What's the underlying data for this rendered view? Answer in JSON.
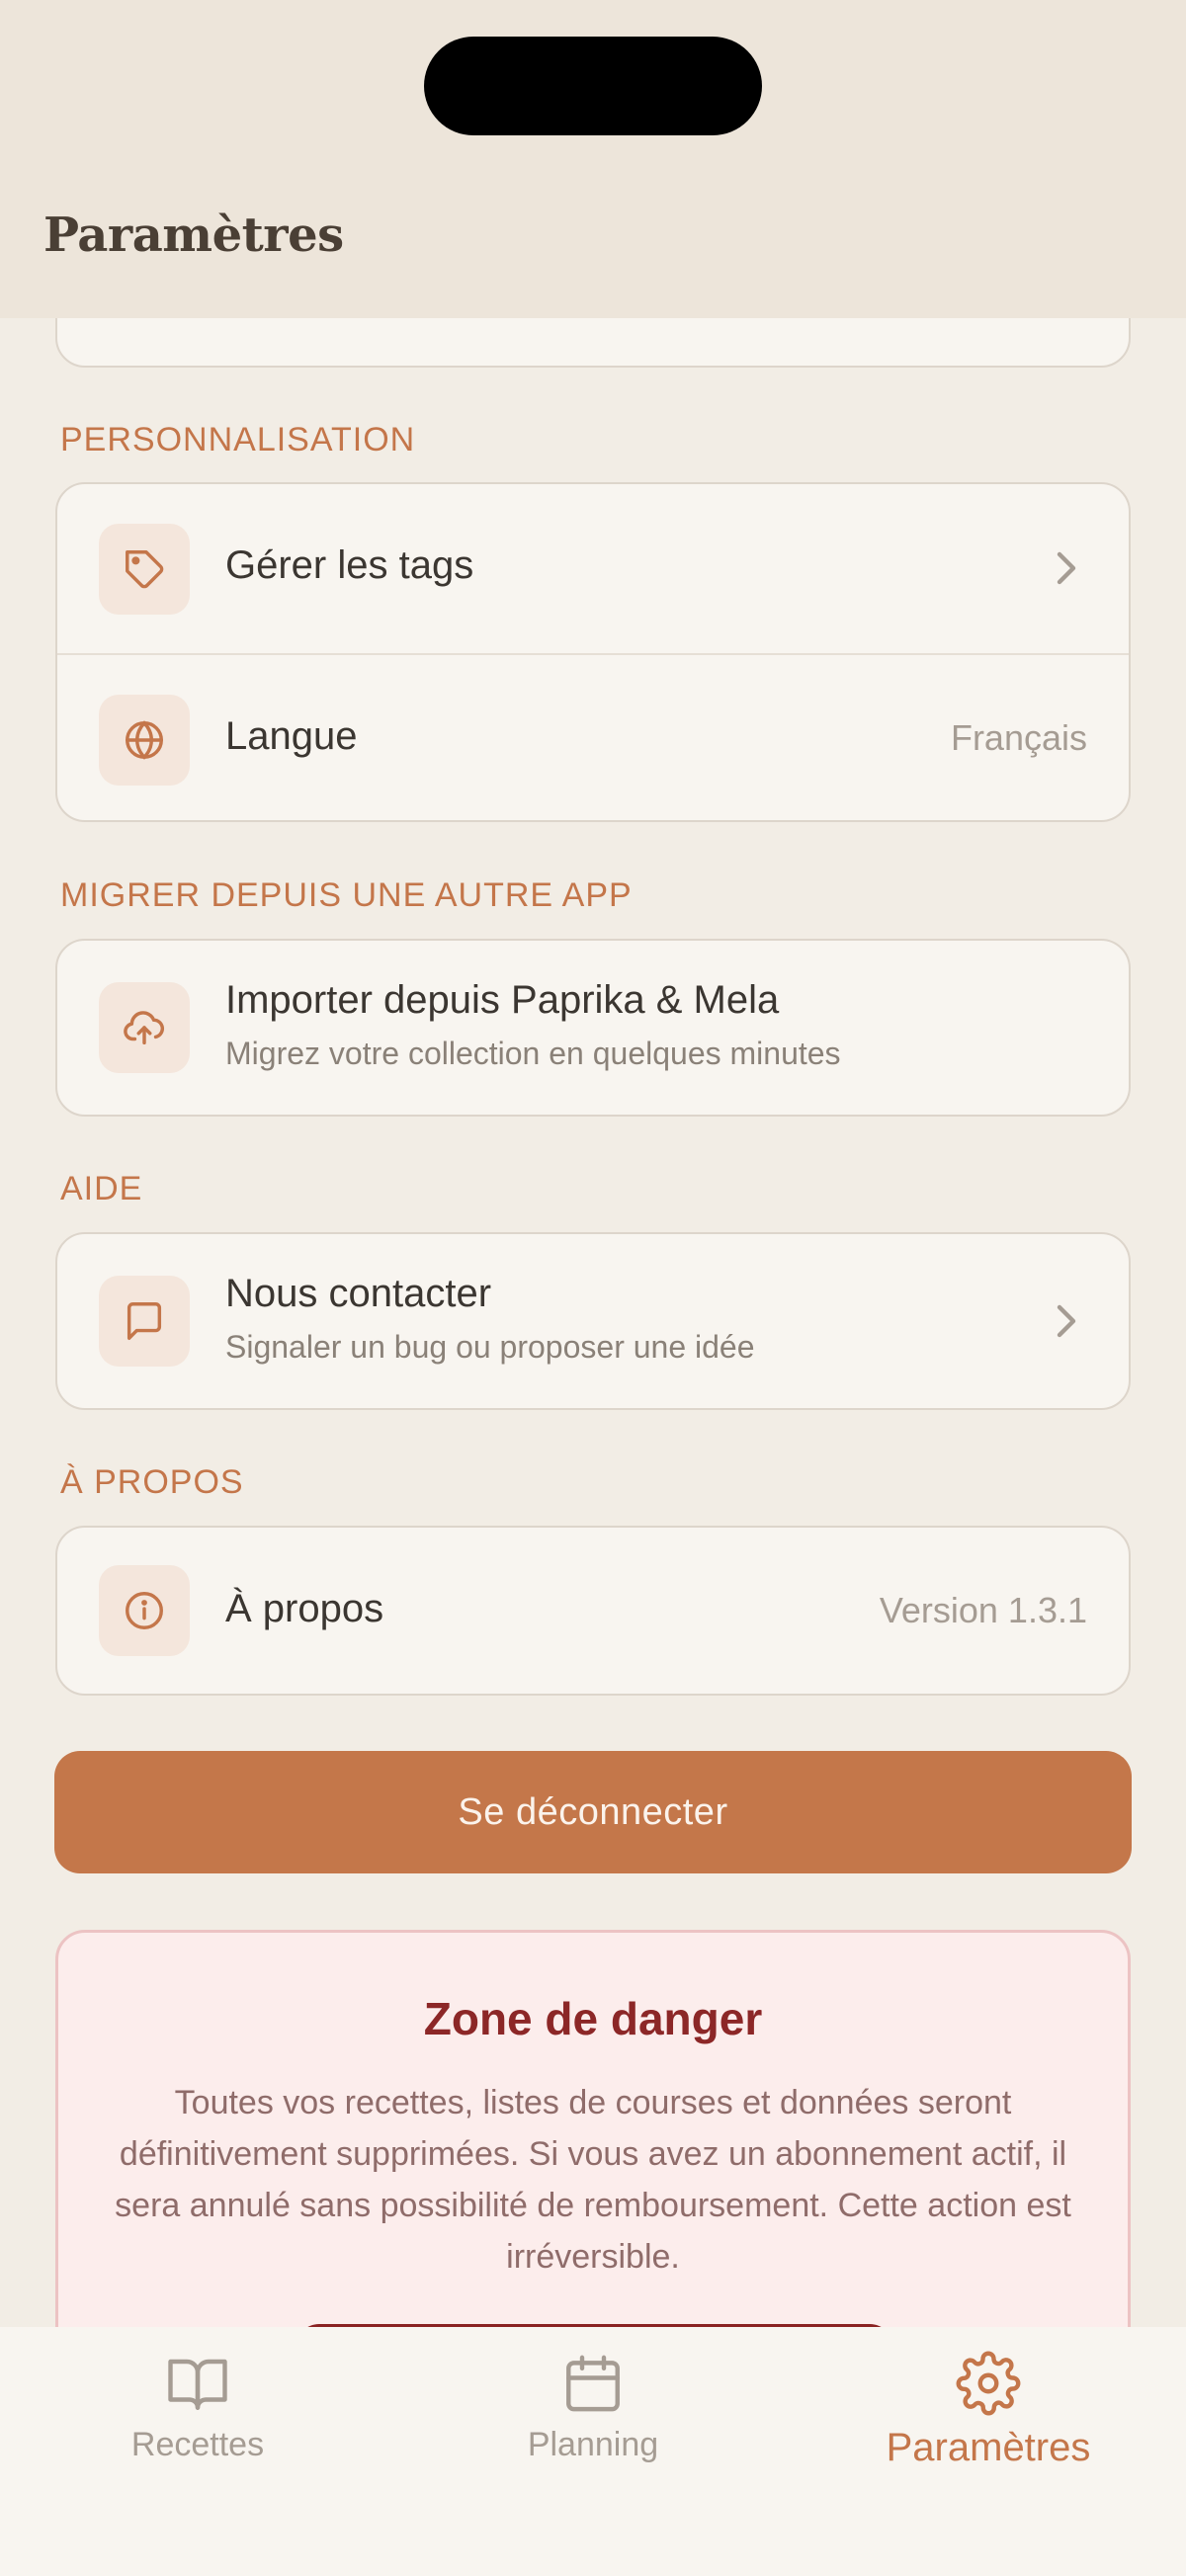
{
  "header": {
    "title": "Paramètres"
  },
  "sections": {
    "personalisation": {
      "label": "PERSONNALISATION",
      "tags": {
        "title": "Gérer les tags",
        "icon": "tag-icon"
      },
      "language": {
        "title": "Langue",
        "value": "Français",
        "icon": "globe-icon"
      }
    },
    "migrate": {
      "label": "MIGRER DEPUIS UNE AUTRE APP",
      "import": {
        "title": "Importer depuis Paprika & Mela",
        "subtitle": "Migrez votre collection en quelques minutes",
        "icon": "cloud-upload-icon"
      }
    },
    "help": {
      "label": "AIDE",
      "contact": {
        "title": "Nous contacter",
        "subtitle": "Signaler un bug ou proposer une idée",
        "icon": "message-icon"
      }
    },
    "about": {
      "label": "À PROPOS",
      "about": {
        "title": "À propos",
        "value": "Version 1.3.1",
        "icon": "info-icon"
      }
    }
  },
  "logout": {
    "label": "Se déconnecter"
  },
  "danger": {
    "title": "Zone de danger",
    "text": "Toutes vos recettes, listes de courses et données seront définitivement supprimées. Si vous avez un abonnement actif, il sera annulé sans possibilité de remboursement. Cette action est irréversible."
  },
  "tabs": [
    {
      "label": "Recettes",
      "icon": "book-icon",
      "active": false
    },
    {
      "label": "Planning",
      "icon": "calendar-icon",
      "active": false
    },
    {
      "label": "Paramètres",
      "icon": "gear-icon",
      "active": true
    }
  ],
  "colors": {
    "accent": "#c4764a",
    "background": "#f2ede5",
    "danger": "#8c2727",
    "danger_bg": "#fcedec"
  }
}
